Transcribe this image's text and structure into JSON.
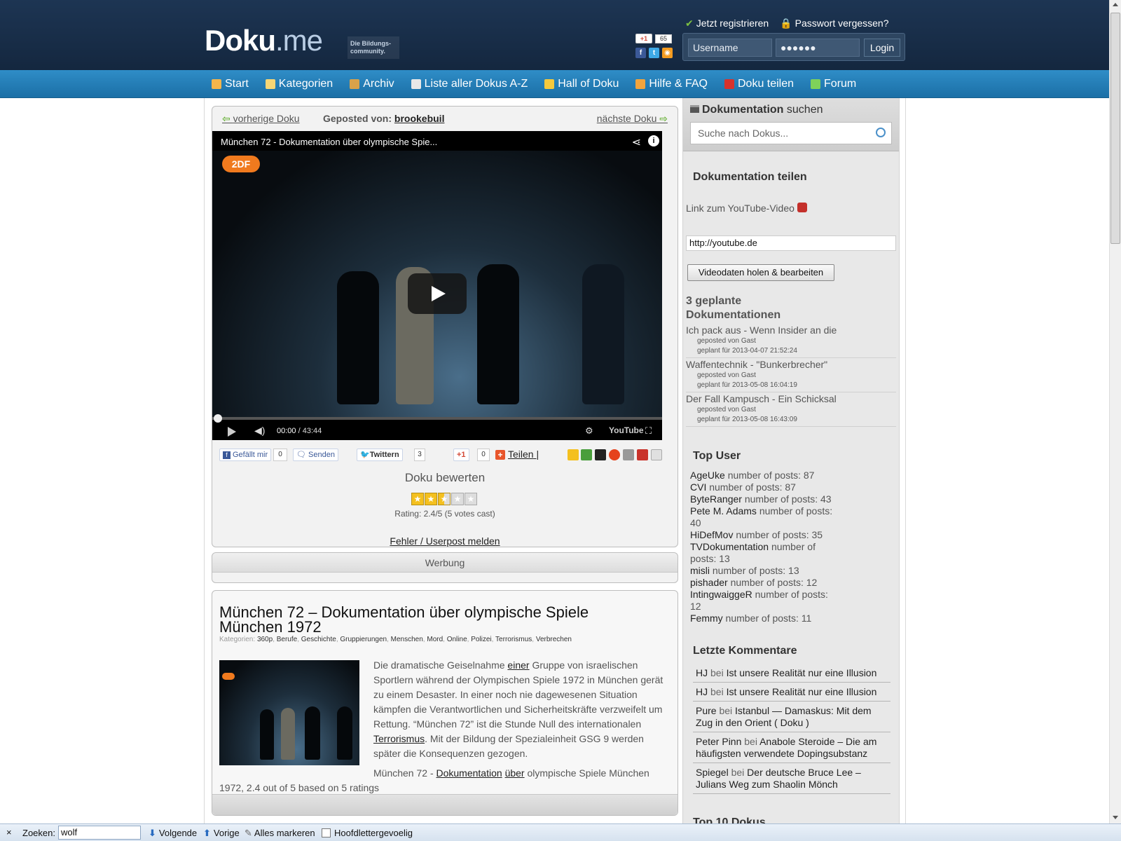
{
  "header": {
    "logo_main": "Doku",
    "logo_ext": ".me",
    "logo_tagline": "Die Bildungs-community.",
    "gplus_label": "+1",
    "gplus_count": "65",
    "register_label": "Jetzt registrieren",
    "forgot_label": "Passwort vergessen?",
    "username_value": "Username",
    "password_value": "●●●●●●",
    "login_label": "Login"
  },
  "nav": {
    "items": [
      {
        "label": "Start",
        "icon": "home-icon",
        "color": "#f4b54b"
      },
      {
        "label": "Kategorien",
        "icon": "folder-icon",
        "color": "#f7d675"
      },
      {
        "label": "Archiv",
        "icon": "box-icon",
        "color": "#d9a24a"
      },
      {
        "label": "Liste aller Dokus A-Z",
        "icon": "calendar-icon",
        "color": "#e8e8e8"
      },
      {
        "label": "Hall of Doku",
        "icon": "trophy-icon",
        "color": "#f6c93c"
      },
      {
        "label": "Hilfe & FAQ",
        "icon": "help-icon",
        "color": "#f3a43c"
      },
      {
        "label": "Doku teilen",
        "icon": "youtube-icon",
        "color": "#d8322c"
      },
      {
        "label": "Forum",
        "icon": "chat-icon",
        "color": "#7fd25a"
      }
    ]
  },
  "post": {
    "prev_label": "vorherige Doku",
    "posted_by_label": "Geposted von:",
    "posted_by_user": "brookebuil",
    "next_label": "nächste Doku"
  },
  "player": {
    "title": "München 72 - Dokumentation über olympische Spie...",
    "channel_logo": "2DF",
    "time_current": "00:00",
    "time_total": "/ 43:44",
    "youtube_label": "YouTube",
    "progress": 0
  },
  "share": {
    "facebook_label": "Gefällt mir",
    "facebook_count": "0",
    "send_label": "Senden",
    "twitter_label": "Twittern",
    "twitter_count": "3",
    "gplus_label": "+1",
    "gplus_count": "0",
    "share_label": "Teilen",
    "divider": "|"
  },
  "rating": {
    "title": "Doku bewerten",
    "value": 2.4,
    "max": 5,
    "text": "Rating: 2.4/5 (5 votes cast)",
    "report_label": "Fehler / Userpost melden"
  },
  "ad": {
    "label": "Werbung"
  },
  "article": {
    "title": "München 72 – Dokumentation über olympische Spiele München 1972",
    "categories_label": "Kategorien:",
    "categories": [
      "360p",
      "Berufe",
      "Geschichte",
      "Gruppierungen",
      "Menschen",
      "Mord",
      "Online",
      "Polizei",
      "Terrorismus",
      "Verbrechen"
    ],
    "text_1": "Die dramatische Geiselnahme ",
    "link_1": "einer",
    "text_2": " Gruppe von israelischen Sportlern während der Olympischen Spiele 1972 in München gerät zu einem Desaster. In einer noch nie dagewesenen Situation kämpfen die Verantwortlichen und Sicherheitskräfte verzweifelt um Rettung. “München 72” ist die Stunde Null des internationalen ",
    "link_2": "Terrorismus",
    "text_3": ". Mit der Bildung der Spezialeinheit GSG 9 werden später die Konsequenzen gezogen.",
    "foot_1": "München 72 - ",
    "foot_link_1": "Dokumentation",
    "foot_space": " ",
    "foot_link_2": "über",
    "foot_2": " olympische Spiele München 1972, 2.4 out of 5 based on 5 ratings"
  },
  "sidebar": {
    "search_title_bold": "Dokumentation",
    "search_title_rest": " suchen",
    "search_placeholder": "Suche nach Dokus...",
    "share_title": "Dokumentation teilen",
    "yt_link_label": "Link zum YouTube-Video",
    "url_value": "http://youtube.de",
    "fetch_label": "Videodaten holen & bearbeiten",
    "planned_title": "3 geplante Dokumentationen",
    "planned": [
      {
        "title": "Ich pack aus - Wenn Insider an die",
        "by": "geposted von Gast",
        "date": "geplant für 2013-04-07 21:52:24"
      },
      {
        "title": "Waffentechnik - \"Bunkerbrecher\"",
        "by": "geposted von Gast",
        "date": "geplant für 2013-05-08 16:04:19"
      },
      {
        "title": "Der Fall Kampusch - Ein Schicksal",
        "by": "geposted von Gast",
        "date": "geplant für 2013-05-08 16:43:09"
      }
    ],
    "top_user_title": "Top User",
    "top_users": [
      {
        "name": "AgeUke",
        "text": " number of posts: 87"
      },
      {
        "name": "CVI",
        "text": " number of posts: 87"
      },
      {
        "name": "ByteRanger",
        "text": " number of posts: 43"
      },
      {
        "name": "Pete M. Adams",
        "text": " number of posts: 40"
      },
      {
        "name": "HiDefMov",
        "text": " number of posts: 35"
      },
      {
        "name": "TVDokumentation",
        "text": " number of posts: 13"
      },
      {
        "name": "misli",
        "text": " number of posts: 13"
      },
      {
        "name": "pishader",
        "text": " number of posts: 12"
      },
      {
        "name": "IntingwaiggeR",
        "text": " number of posts: 12"
      },
      {
        "name": "Femmy",
        "text": " number of posts: 11"
      }
    ],
    "comments_title": "Letzte Kommentare",
    "comments": [
      {
        "author": "HJ",
        "bei": " bei ",
        "post": "Ist unsere Realität nur eine Illusion"
      },
      {
        "author": "HJ",
        "bei": " bei ",
        "post": "Ist unsere Realität nur eine Illusion"
      },
      {
        "author": "Pure",
        "bei": " bei ",
        "post": "Istanbul — Damaskus: Mit dem Zug in den Orient ( Doku )"
      },
      {
        "author": "Peter Pinn",
        "bei": " bei ",
        "post": "Anabole Steroide – Die am häufigsten verwendete Dopingsubstanz"
      },
      {
        "author": "Spiegel",
        "bei": " bei ",
        "post": "Der deutsche Bruce Lee – Julians Weg zum Shaolin Mönch"
      }
    ],
    "top10_title": "Top 10 Dokus"
  },
  "findbar": {
    "close": "×",
    "label": "Zoeken:",
    "value": "wolf",
    "next_label": "Volgende",
    "prev_label": "Vorige",
    "highlight_label": "Alles markeren",
    "case_label": "Hoofdlettergevoelig"
  }
}
